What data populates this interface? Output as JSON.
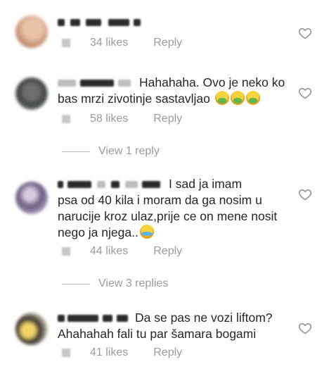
{
  "comments": [
    {
      "text": "",
      "likes": "34 likes",
      "reply": "Reply"
    },
    {
      "text_line1": "Hahahaha. Ovo je neko ko",
      "text_line2": "bas mrzi zivotinje sastavljao",
      "emoji": "nauseated-face",
      "likes": "58 likes",
      "reply": "Reply",
      "view_replies": "View 1 reply"
    },
    {
      "text_line1": "I sad ja imam",
      "text_line2": "psa od 40 kila i moram da ga nosim u",
      "text_line3": "narucije kroz ulaz,prije ce on mene nosit",
      "text_line4": "nego ja njega..",
      "emoji": "tears-of-joy",
      "likes": "44 likes",
      "reply": "Reply",
      "view_replies": "View 3 replies"
    },
    {
      "text_line1": "Da se pas ne vozi liftom?",
      "text_line2": "Ahahahah fali tu par šamara bogami",
      "likes": "41 likes",
      "reply": "Reply"
    }
  ],
  "colors": {
    "text": "#262626",
    "meta": "#9a9a9a",
    "heart_stroke": "#8e8e8e"
  }
}
